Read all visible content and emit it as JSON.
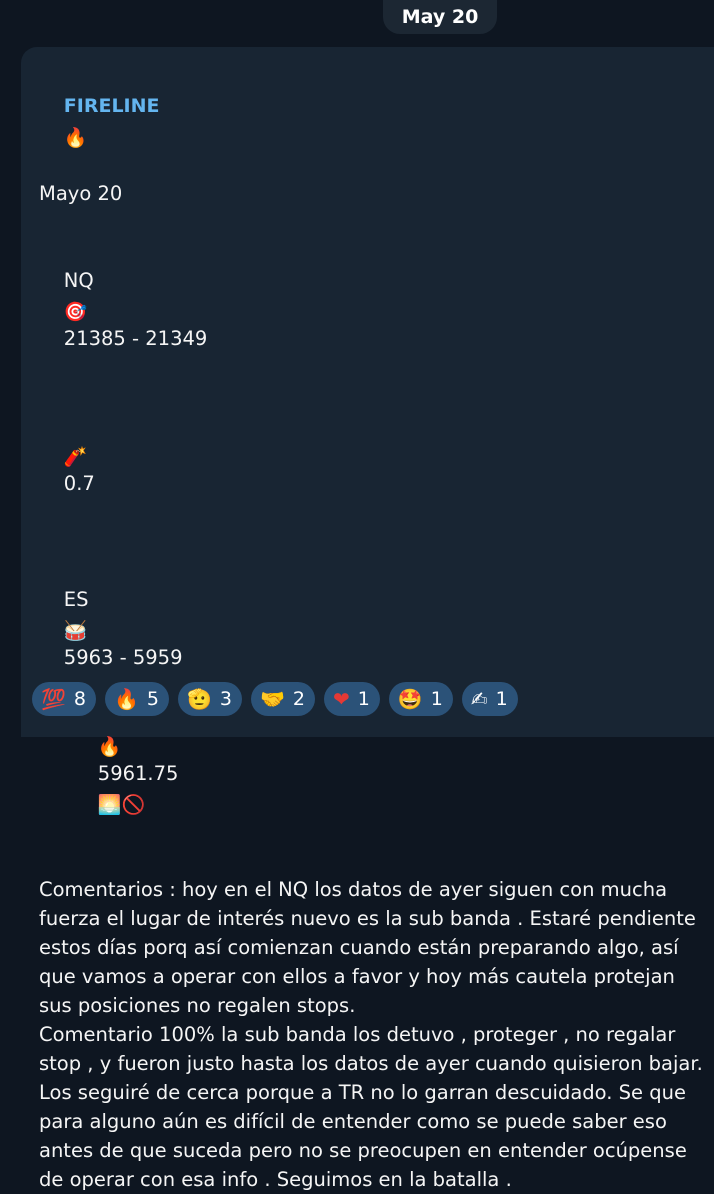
{
  "date_pill": "May 20",
  "message": {
    "sender": "FIRELINE",
    "sender_icon": "🔥",
    "lines": {
      "date": "Mayo 20",
      "nq_label": "NQ",
      "nq_icon": "🎯",
      "nq_value": "21385 - 21349",
      "dyn_icon": "🧨",
      "dyn_value": "0.7",
      "es_label": "ES",
      "es_icon": "🥁",
      "es_value": "5963 - 5959",
      "fire_icon": "🔥",
      "fire_value": "5961.75",
      "sunset_icon": "🌅",
      "no_icon": "🚫"
    },
    "comment1": "Comentarios : hoy en el NQ los datos de ayer siguen con mucha fuerza el lugar de interés nuevo es la sub banda . Estaré pendiente estos días porq así comienzan cuando están preparando algo, así que vamos a operar con ellos a favor y hoy más cautela protejan sus posiciones no regalen stops.",
    "comment2": "Comentario 100% la sub banda los detuvo , proteger , no regalar stop , y fueron justo hasta los datos de ayer cuando quisieron bajar. Los seguiré de cerca porque a TR no lo garran descuidado. Se que para alguno aún es difícil de entender como se puede saber eso antes de que suceda pero no se preocupen en entender ocúpense de operar con esa info . Seguimos en la batalla ."
  },
  "reactions": [
    {
      "icon": "💯",
      "count": "8"
    },
    {
      "icon": "🔥",
      "count": "5"
    },
    {
      "icon": "🫡",
      "count": "3"
    },
    {
      "icon": "🤝",
      "count": "2"
    },
    {
      "icon": "❤",
      "count": "1"
    },
    {
      "icon": "🤩",
      "count": "1"
    },
    {
      "icon": "✍",
      "count": "1"
    }
  ]
}
